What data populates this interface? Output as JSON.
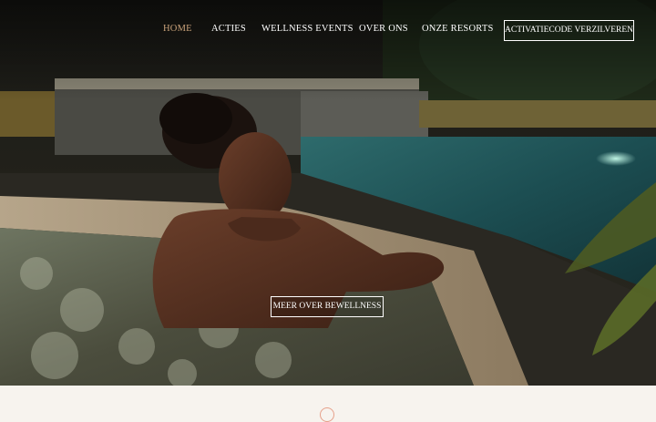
{
  "nav": {
    "items": [
      {
        "label": "HOME",
        "active": true
      },
      {
        "label": "ACTIES",
        "active": false
      },
      {
        "label": "WELLNESS EVENTS",
        "active": false
      },
      {
        "label": "OVER ONS",
        "active": false
      },
      {
        "label": "ONZE RESORTS",
        "active": false
      }
    ],
    "cta_label": "ACTIVATIECODE VERZILVEREN"
  },
  "hero": {
    "button_label": "MEER OVER BEWELLNESS",
    "image_alt": "woman-relaxing-in-hot-tub"
  },
  "colors": {
    "accent": "#c9a27a",
    "footer_bg": "#f7f3ee",
    "logo_accent": "#e6a08a"
  }
}
